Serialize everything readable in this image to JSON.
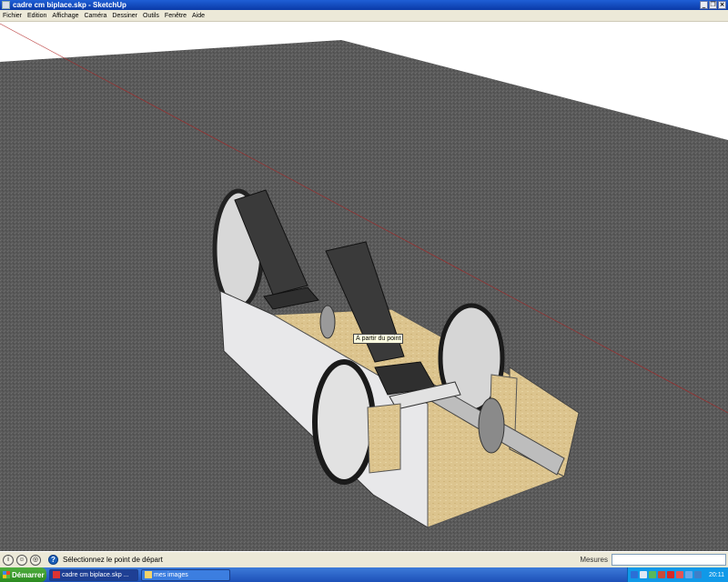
{
  "window": {
    "title": "cadre cm biplace.skp - SketchUp",
    "controls": {
      "minimize": "_",
      "restore": "❐",
      "close": "×"
    }
  },
  "menu": {
    "items": [
      "Fichier",
      "Edition",
      "Affichage",
      "Caméra",
      "Dessiner",
      "Outils",
      "Fenêtre",
      "Aide"
    ]
  },
  "viewport": {
    "tooltip": "À partir du point",
    "ground_color": "#5b5b5b",
    "sky_color": "#ffffff",
    "axis_color": "#b02020"
  },
  "statusbar": {
    "icons": [
      "info-icon",
      "person-icon",
      "geo-icon"
    ],
    "help_symbol": "?",
    "status_text": "Sélectionnez le point de départ",
    "measure_label": "Mesures",
    "measure_value": ""
  },
  "taskbar": {
    "start_label": "Démarrer",
    "tasks": [
      {
        "label": "cadre cm biplace.skp ...",
        "active": true,
        "icon": "sketchup-icon"
      },
      {
        "label": "mes images",
        "active": false,
        "icon": "folder-icon"
      }
    ],
    "tray_icons": [
      "network-icon",
      "update-icon",
      "chat-icon",
      "volume-icon",
      "antivirus-icon",
      "security-icon",
      "sync-icon",
      "shield-icon"
    ],
    "clock": "20:11"
  }
}
